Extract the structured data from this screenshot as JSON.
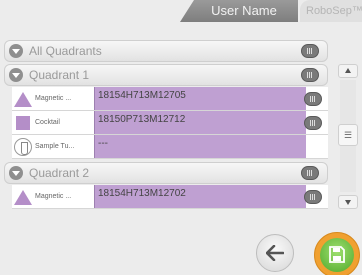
{
  "header": {
    "user_tab_label": "User Name",
    "app_tab_label": "RoboSep™-S"
  },
  "list": {
    "all_quadrants_label": "All Quadrants",
    "quadrants": [
      {
        "label": "Quadrant 1",
        "samples": [
          {
            "type_label": "Magnetic ...",
            "icon": "triangle-icon",
            "value": "18154H713M12705"
          },
          {
            "type_label": "Cocktail",
            "icon": "square-icon",
            "value": "18150P713M12712"
          },
          {
            "type_label": "Sample Tu...",
            "icon": "sample-tube-icon",
            "value": "---"
          }
        ]
      },
      {
        "label": "Quadrant 2",
        "samples": [
          {
            "type_label": "Magnetic ...",
            "icon": "triangle-icon",
            "value": "18154H713M12702"
          }
        ]
      }
    ]
  },
  "scrollbar": {
    "thumb_glyph": "☰"
  },
  "colors": {
    "field_purple": "#bfa0d2",
    "icon_purple": "#b48ec8",
    "save_green": "#5cb531",
    "save_ring": "#f0a030"
  }
}
